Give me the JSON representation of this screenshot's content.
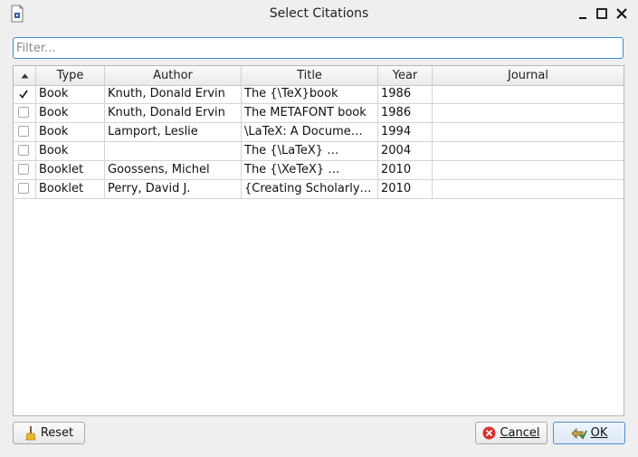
{
  "window": {
    "title": "Select Citations"
  },
  "filter": {
    "placeholder": "Filter...",
    "value": ""
  },
  "table": {
    "columns": [
      "",
      "Type",
      "Author",
      "Title",
      "Year",
      "Journal"
    ],
    "rows": [
      {
        "checked": true,
        "type": "Book",
        "author": "Knuth, Donald Ervin",
        "title": "The {\\TeX}book",
        "year": "1986",
        "journal": ""
      },
      {
        "checked": false,
        "type": "Book",
        "author": "Knuth, Donald Ervin",
        "title": "The METAFONT book",
        "year": "1986",
        "journal": ""
      },
      {
        "checked": false,
        "type": "Book",
        "author": "Lamport, Leslie",
        "title": "\\LaTeX: A Docume…",
        "year": "1994",
        "journal": ""
      },
      {
        "checked": false,
        "type": "Book",
        "author": "",
        "title": "The {\\LaTeX} …",
        "year": "2004",
        "journal": ""
      },
      {
        "checked": false,
        "type": "Booklet",
        "author": "Goossens, Michel",
        "title": "The {\\XeTeX} …",
        "year": "2010",
        "journal": ""
      },
      {
        "checked": false,
        "type": "Booklet",
        "author": "Perry, David J.",
        "title": "{Creating Scholarly…",
        "year": "2010",
        "journal": ""
      }
    ]
  },
  "buttons": {
    "reset": "Reset",
    "cancel": "Cancel",
    "ok": "OK"
  },
  "icons": {
    "app": "document-icon",
    "minimize": "minimize-icon",
    "maximize": "maximize-icon",
    "close": "close-icon",
    "sort": "sort-ascending-icon",
    "check": "checkmark-icon",
    "reset": "broom-icon",
    "cancel": "cancel-icon",
    "ok": "ok-icon"
  },
  "colors": {
    "accent": "#3d8fd6",
    "cancel_red": "#d9302c",
    "background": "#efefef"
  }
}
